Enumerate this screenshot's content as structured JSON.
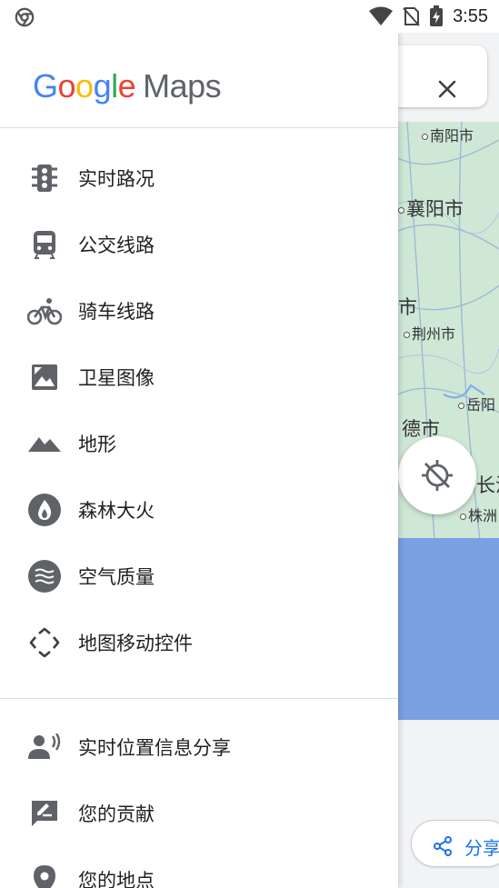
{
  "status_bar": {
    "time": "3:55"
  },
  "drawer": {
    "logo": {
      "google_letters": [
        "G",
        "o",
        "o",
        "g",
        "l",
        "e"
      ],
      "maps": "Maps"
    },
    "layers": [
      {
        "label": "实时路况",
        "icon": "traffic-light-icon"
      },
      {
        "label": "公交线路",
        "icon": "transit-icon"
      },
      {
        "label": "骑车线路",
        "icon": "bicycle-icon"
      },
      {
        "label": "卫星图像",
        "icon": "satellite-icon"
      },
      {
        "label": "地形",
        "icon": "terrain-icon"
      },
      {
        "label": "森林大火",
        "icon": "wildfire-icon"
      },
      {
        "label": "空气质量",
        "icon": "air-quality-icon"
      },
      {
        "label": "地图移动控件",
        "icon": "map-controls-icon"
      }
    ],
    "actions": [
      {
        "label": "实时位置信息分享",
        "icon": "location-sharing-icon"
      },
      {
        "label": "您的贡献",
        "icon": "contribute-icon"
      },
      {
        "label": "您的地点",
        "icon": "place-pin-icon"
      }
    ]
  },
  "map": {
    "cities": [
      {
        "name": "南阳市"
      },
      {
        "name": "襄阳市"
      },
      {
        "name": "市"
      },
      {
        "name": "荆州市"
      },
      {
        "name": "岳阳"
      },
      {
        "name": "德市"
      },
      {
        "name": "长沙"
      },
      {
        "name": "株洲"
      }
    ],
    "share_label": "分享"
  },
  "colors": {
    "google_blue": "#4285F4",
    "google_red": "#EA4335",
    "google_yellow": "#FBBC05",
    "google_green": "#34A853",
    "icon_gray": "#5f6368",
    "share_blue": "#1a73e8"
  }
}
